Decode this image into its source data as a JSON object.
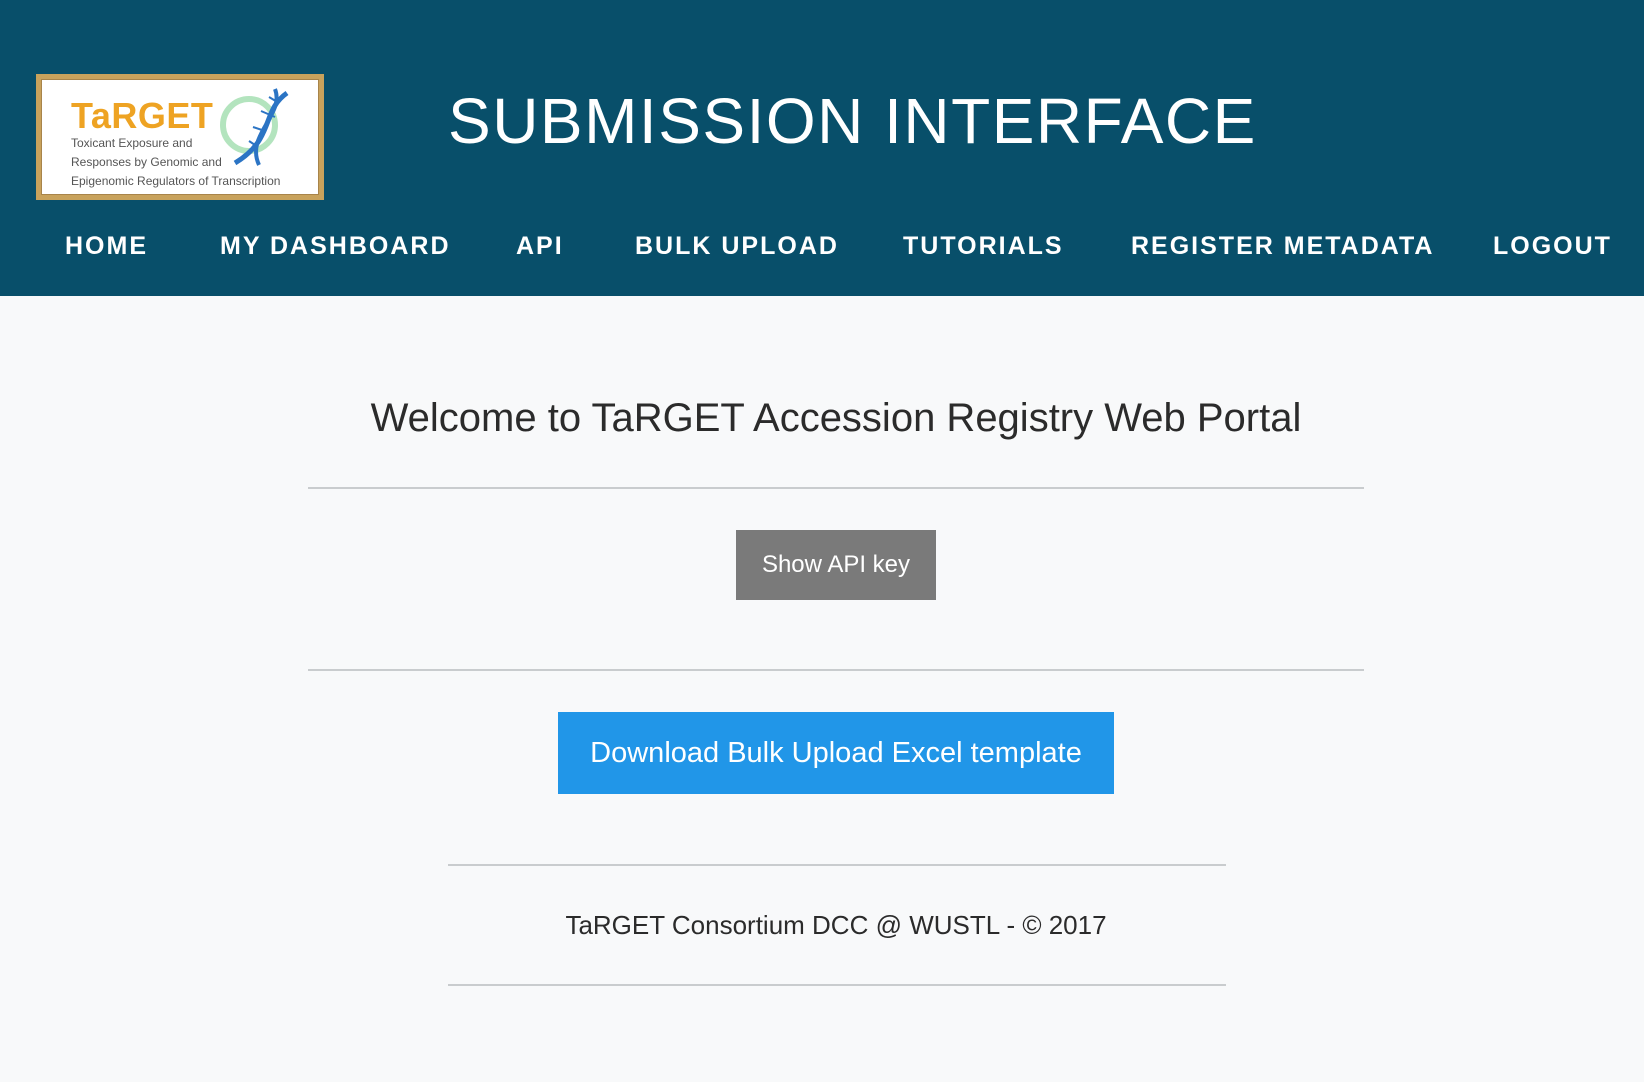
{
  "header": {
    "logo": {
      "wordmark": "TaRGET",
      "subtitle_lines": [
        "Toxicant Exposure and",
        "Responses by Genomic and",
        "Epigenomic Regulators of Transcription"
      ],
      "icon": "dna-icon"
    },
    "site_title": "SUBMISSION INTERFACE",
    "nav": [
      {
        "label": "HOME"
      },
      {
        "label": "MY DASHBOARD"
      },
      {
        "label": "API"
      },
      {
        "label": "BULK UPLOAD"
      },
      {
        "label": "TUTORIALS"
      },
      {
        "label": "REGISTER METADATA"
      },
      {
        "label": "LOGOUT"
      }
    ]
  },
  "main": {
    "welcome": "Welcome to TaRGET Accession Registry Web Portal",
    "api_key_button": "Show API key",
    "download_button": "Download Bulk Upload Excel template"
  },
  "footer": {
    "text": "TaRGET Consortium DCC @ WUSTL - © 2017"
  },
  "colors": {
    "header_bg": "#084f6a",
    "page_bg": "#f8f9fa",
    "api_button_bg": "#7a7a7a",
    "download_button_bg": "#2196e8",
    "logo_accent": "#eea323"
  }
}
